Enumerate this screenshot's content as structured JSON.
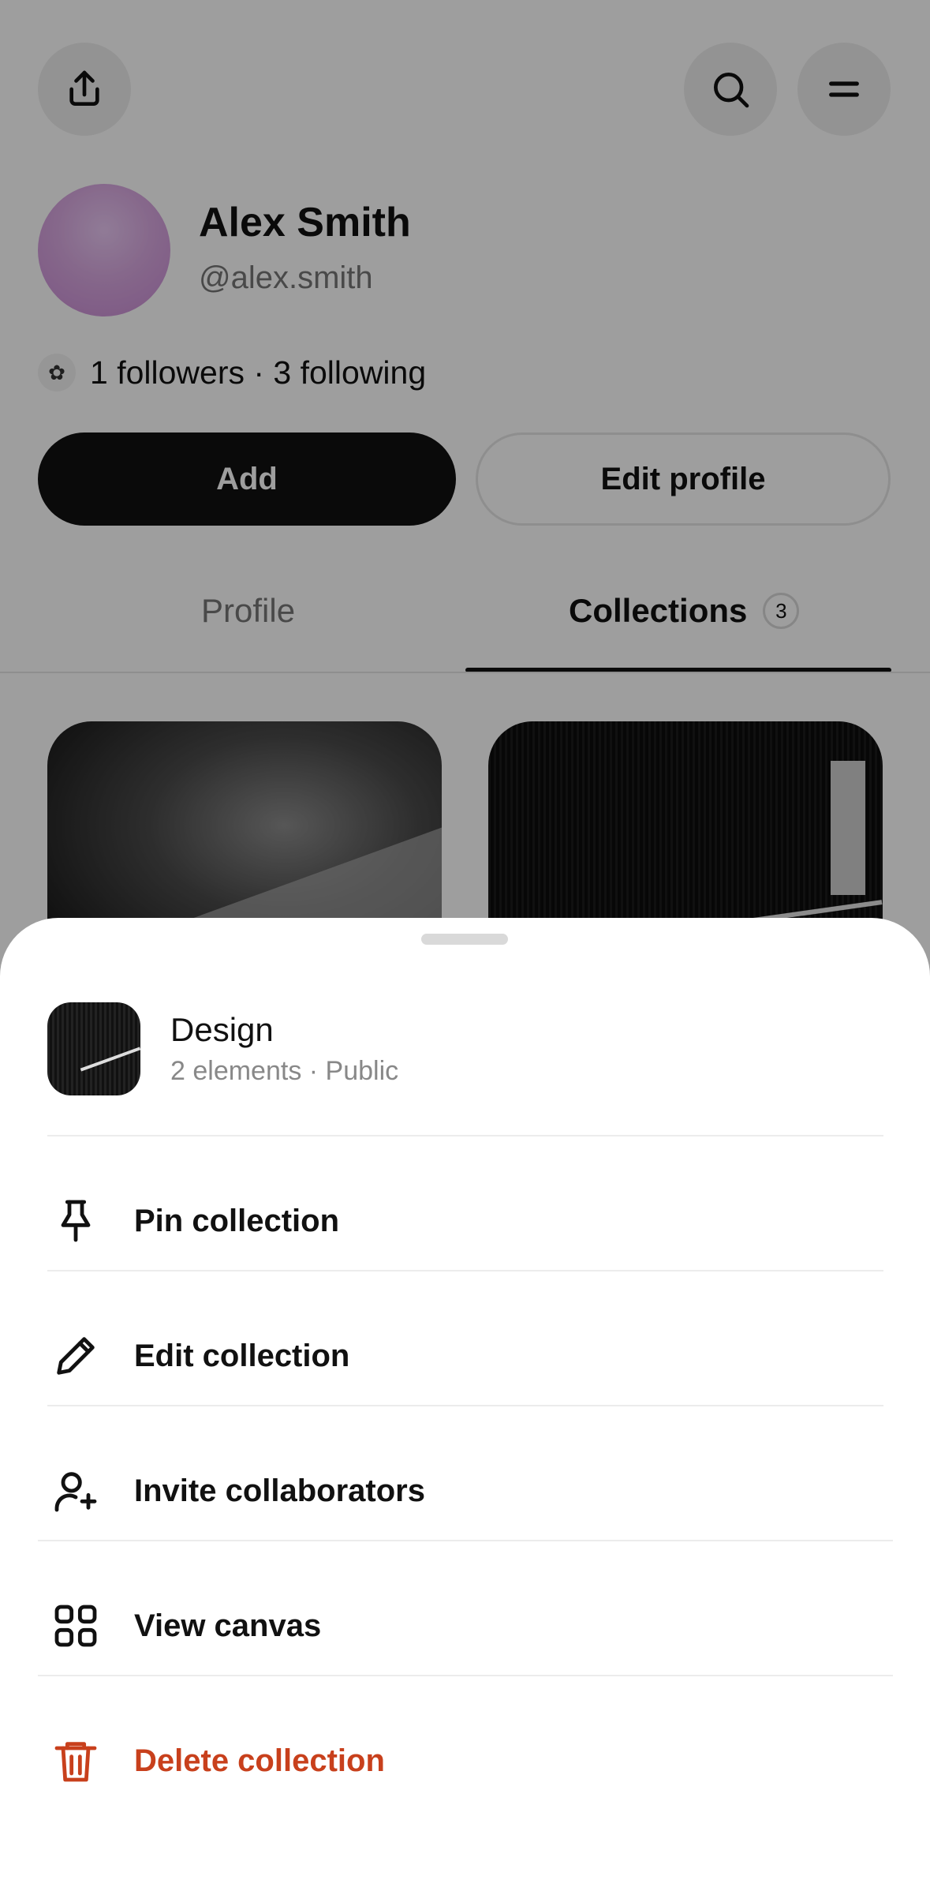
{
  "header": {
    "share_icon": "share-icon",
    "search_icon": "search-icon",
    "menu_icon": "menu-icon"
  },
  "profile": {
    "name": "Alex Smith",
    "handle": "@alex.smith",
    "stats": "1 followers · 3 following",
    "add_label": "Add",
    "edit_label": "Edit profile"
  },
  "tabs": {
    "profile_label": "Profile",
    "collections_label": "Collections",
    "collections_count": "3"
  },
  "sheet": {
    "collection": {
      "title": "Design",
      "subtitle": "2 elements · Public"
    },
    "menu": [
      {
        "label": "Pin collection",
        "icon": "pin-icon"
      },
      {
        "label": "Edit collection",
        "icon": "pencil-icon"
      },
      {
        "label": "Invite collaborators",
        "icon": "user-plus-icon"
      },
      {
        "label": "View canvas",
        "icon": "grid-icon"
      },
      {
        "label": "Delete collection",
        "icon": "trash-icon"
      }
    ]
  },
  "colors": {
    "accent_dark": "#111111",
    "danger": "#c8401c",
    "overlay": "rgba(0,0,0,0.38)"
  }
}
